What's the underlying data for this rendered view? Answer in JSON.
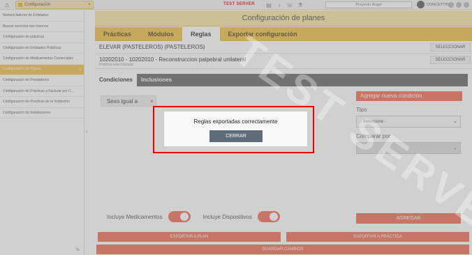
{
  "topbar": {
    "tab_label": "Configuración",
    "tab_close": "×",
    "test_label": "TEST SERVER",
    "project": "Proyecto Ángel",
    "user": "CONCETTINI"
  },
  "sidebar": {
    "items": [
      "Nomencladores de Entidades",
      "Buscar servicios nos Internos",
      "Configuración de prácticas",
      "Configuración de Entidades Prácticas",
      "Configuración de Medicamentos Comerciales",
      "Configuración de Planes",
      "Configuración de Prestadores",
      "Configuración de Prácticas a Facturar por C...",
      "Configuración de Prácticas de la Institución",
      "Configuración de Instalaciones"
    ],
    "active_index": 5
  },
  "main": {
    "title": "Configuración de planes",
    "tabs": [
      "Prácticas",
      "Módulos",
      "Reglas",
      "Exportar configuración"
    ],
    "active_tab": 2,
    "plan_label": "ELEVAR (PASTELEROS) (PASTELEROS)",
    "practice_label": "10202010 - 10202010 - Reconstruccion palpebral unilateral",
    "practice_sub": "Práctica seleccionada",
    "select_btn": "SELECCIONAR",
    "subtabs": [
      "Condiciones",
      "Inclusiones"
    ],
    "condition": "Sexo igual a",
    "condition_close": "×",
    "add_condition": "Agregar nueva condición",
    "tipo_label": "Tipo",
    "tipo_value": "- Seleccione -",
    "comparar_label": "Comparar por",
    "agregar": "AGREGAR",
    "incluye_medicamentos": "Incluye Medicamentos",
    "incluye_dispositivos": "Incluye Dispositivos",
    "exportar_plan": "EXPORTAR A PLAN",
    "exportar_practica": "EXPORTAR A PRÁCTICA",
    "guardar": "GUARDAR CAMBIOS"
  },
  "dialog": {
    "message": "Reglas exportadas correctamente",
    "close_label": "CERRAR"
  },
  "watermark": "TEST SERVER"
}
